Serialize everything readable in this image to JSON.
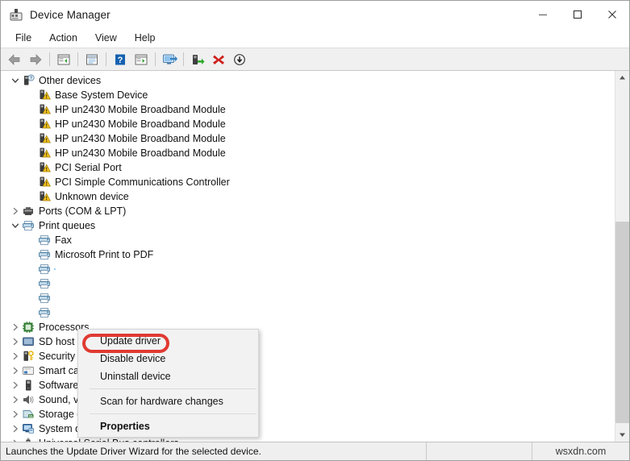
{
  "window": {
    "title": "Device Manager",
    "icon": "device-manager-icon",
    "controls": {
      "minimize": "—",
      "maximize": "☐",
      "close": "✕"
    }
  },
  "menubar": {
    "items": [
      {
        "label": "File",
        "name": "menu-file"
      },
      {
        "label": "Action",
        "name": "menu-action"
      },
      {
        "label": "View",
        "name": "menu-view"
      },
      {
        "label": "Help",
        "name": "menu-help"
      }
    ]
  },
  "toolbar": {
    "buttons": [
      {
        "name": "back-icon",
        "tip": "Back"
      },
      {
        "name": "forward-icon",
        "tip": "Forward"
      },
      {
        "sep": true
      },
      {
        "name": "show-hide-console-tree-icon",
        "tip": "Show/Hide Console Tree"
      },
      {
        "sep": true
      },
      {
        "name": "properties-icon",
        "tip": "Properties"
      },
      {
        "sep": true
      },
      {
        "name": "help-icon",
        "tip": "Help"
      },
      {
        "name": "show-hide-action-pane-icon",
        "tip": "Show/Hide Action Pane"
      },
      {
        "sep": true
      },
      {
        "name": "scan-for-hardware-changes-icon",
        "tip": "Scan for hardware changes"
      },
      {
        "sep": true
      },
      {
        "name": "update-driver-icon",
        "tip": "Update driver"
      },
      {
        "name": "uninstall-device-icon",
        "tip": "Uninstall device"
      },
      {
        "name": "disable-device-icon",
        "tip": "Disable device"
      }
    ]
  },
  "tree": {
    "rows": [
      {
        "label": "Other devices",
        "indent": 0,
        "twisty": "expanded",
        "icon": "unknown-device-category-icon"
      },
      {
        "label": "Base System Device",
        "indent": 1,
        "twisty": "none",
        "icon": "warning-device-icon"
      },
      {
        "label": "HP un2430 Mobile Broadband Module",
        "indent": 1,
        "twisty": "none",
        "icon": "warning-device-icon"
      },
      {
        "label": "HP un2430 Mobile Broadband Module",
        "indent": 1,
        "twisty": "none",
        "icon": "warning-device-icon"
      },
      {
        "label": "HP un2430 Mobile Broadband Module",
        "indent": 1,
        "twisty": "none",
        "icon": "warning-device-icon"
      },
      {
        "label": "HP un2430 Mobile Broadband Module",
        "indent": 1,
        "twisty": "none",
        "icon": "warning-device-icon"
      },
      {
        "label": "PCI Serial Port",
        "indent": 1,
        "twisty": "none",
        "icon": "warning-device-icon"
      },
      {
        "label": "PCI Simple Communications Controller",
        "indent": 1,
        "twisty": "none",
        "icon": "warning-device-icon"
      },
      {
        "label": "Unknown device",
        "indent": 1,
        "twisty": "none",
        "icon": "warning-device-icon"
      },
      {
        "label": "Ports (COM & LPT)",
        "indent": 0,
        "twisty": "collapsed",
        "icon": "port-icon"
      },
      {
        "label": "Print queues",
        "indent": 0,
        "twisty": "expanded",
        "icon": "printer-icon"
      },
      {
        "label": "Fax",
        "indent": 1,
        "twisty": "none",
        "icon": "printer-icon"
      },
      {
        "label": "Microsoft Print to PDF",
        "indent": 1,
        "twisty": "none",
        "icon": "printer-icon"
      },
      {
        "label": "",
        "indent": 1,
        "twisty": "none",
        "icon": "printer-icon",
        "selected": true
      },
      {
        "label": "",
        "indent": 1,
        "twisty": "none",
        "icon": "printer-icon"
      },
      {
        "label": "",
        "indent": 1,
        "twisty": "none",
        "icon": "printer-icon"
      },
      {
        "label": "",
        "indent": 1,
        "twisty": "none",
        "icon": "printer-icon"
      },
      {
        "label": "Processors",
        "indent": 0,
        "twisty": "collapsed",
        "icon": "processor-icon"
      },
      {
        "label": "SD host adapters",
        "indent": 0,
        "twisty": "collapsed",
        "icon": "sd-host-icon"
      },
      {
        "label": "Security devices",
        "indent": 0,
        "twisty": "collapsed",
        "icon": "security-icon"
      },
      {
        "label": "Smart card readers",
        "indent": 0,
        "twisty": "collapsed",
        "icon": "smartcard-icon"
      },
      {
        "label": "Software devices",
        "indent": 0,
        "twisty": "collapsed",
        "icon": "software-device-icon"
      },
      {
        "label": "Sound, video and game controllers",
        "indent": 0,
        "twisty": "collapsed",
        "icon": "sound-icon"
      },
      {
        "label": "Storage controllers",
        "indent": 0,
        "twisty": "collapsed",
        "icon": "storage-icon"
      },
      {
        "label": "System devices",
        "indent": 0,
        "twisty": "collapsed",
        "icon": "system-device-icon"
      },
      {
        "label": "Universal Serial Bus controllers",
        "indent": 0,
        "twisty": "collapsed",
        "icon": "usb-icon"
      }
    ]
  },
  "context_menu": {
    "items": [
      {
        "label": "Update driver",
        "bold": false,
        "highlighted": true,
        "name": "ctx-update-driver"
      },
      {
        "label": "Disable device",
        "bold": false,
        "name": "ctx-disable-device"
      },
      {
        "label": "Uninstall device",
        "bold": false,
        "name": "ctx-uninstall-device"
      },
      {
        "sep": true
      },
      {
        "label": "Scan for hardware changes",
        "bold": false,
        "name": "ctx-scan-hardware"
      },
      {
        "sep": true
      },
      {
        "label": "Properties",
        "bold": true,
        "name": "ctx-properties"
      }
    ],
    "highlight_color": "#e03a32"
  },
  "statusbar": {
    "message": "Launches the Update Driver Wizard for the selected device.",
    "watermark": "wsxdn.com"
  },
  "scrollbar": {
    "up_arrow": "▲",
    "down_arrow": "▼"
  }
}
